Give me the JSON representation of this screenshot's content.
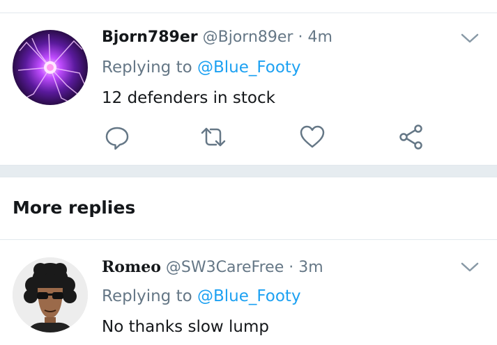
{
  "tweet1": {
    "display_name": "Bjorn789er",
    "handle": "@Bjorn89er",
    "separator": "·",
    "time": "4m",
    "replying_prefix": "Replying to ",
    "replying_to": "@Blue_Footy",
    "text": "12 defenders in stock",
    "avatar": "plasma-ball-avatar",
    "actions": [
      "reply-icon",
      "retweet-icon",
      "like-icon",
      "share-icon"
    ]
  },
  "section": {
    "title": "More replies"
  },
  "tweet2": {
    "display_name": "Romeo",
    "handle": "@SW3CareFree",
    "separator": "·",
    "time": "3m",
    "replying_prefix": "Replying to ",
    "replying_to": "@Blue_Footy",
    "text": "No thanks slow lump",
    "avatar": "sunglasses-man-avatar"
  },
  "colors": {
    "text": "#14171a",
    "secondary": "#657786",
    "link": "#1da1f2",
    "divider": "#e1e8ed",
    "band": "#e6ecf0"
  }
}
